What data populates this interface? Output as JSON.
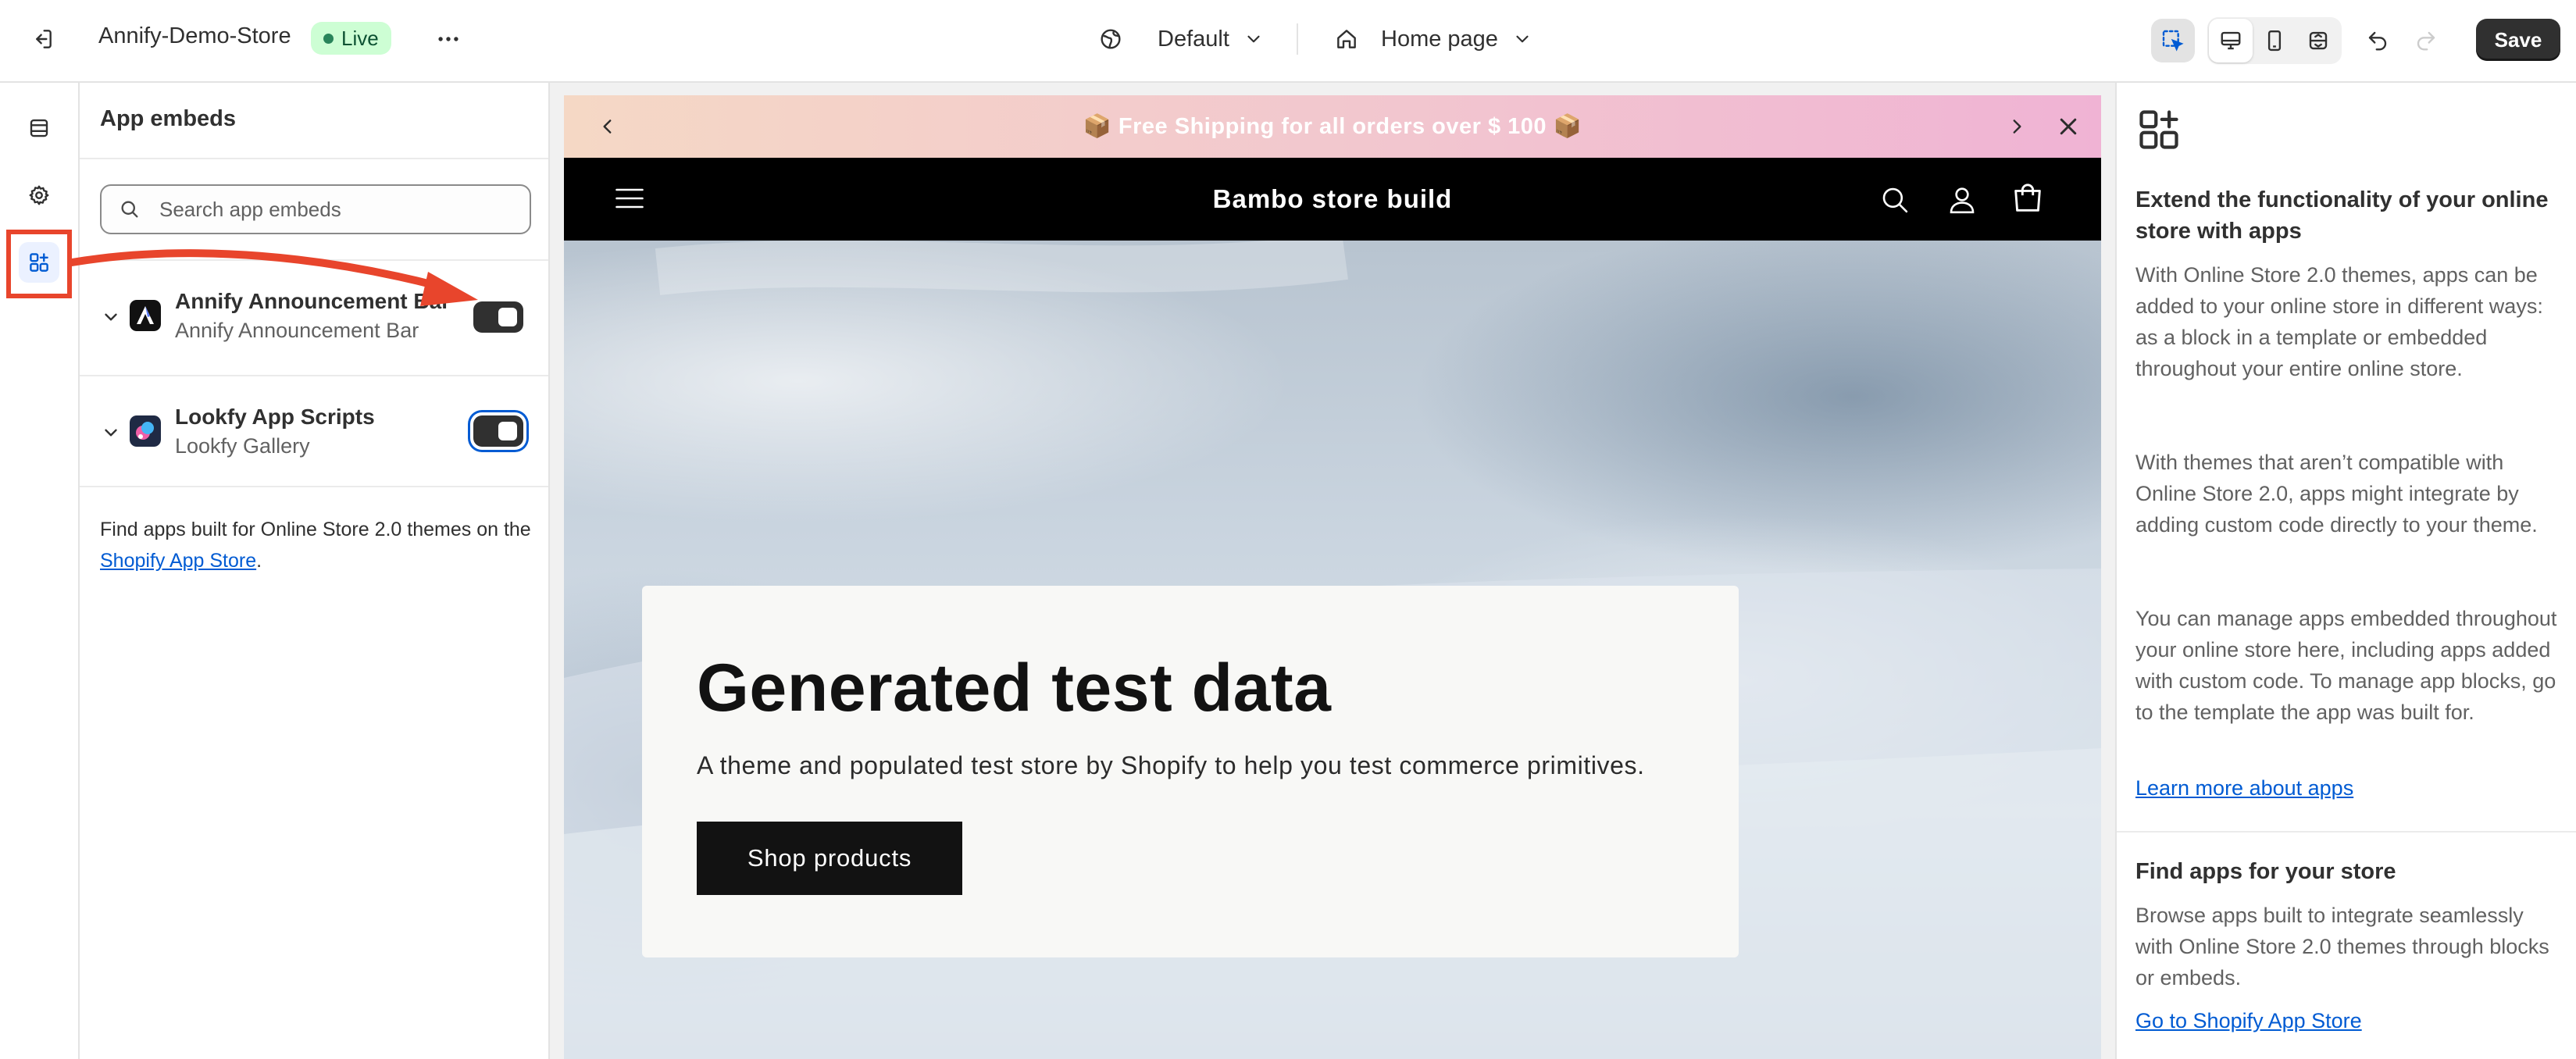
{
  "topbar": {
    "store_name": "Annify-Demo-Store",
    "status_badge": "Live",
    "theme_label": "Default",
    "page_label": "Home page",
    "save_label": "Save"
  },
  "sidebar": {
    "items": [
      {
        "icon": "sections-icon"
      },
      {
        "icon": "gear-icon"
      },
      {
        "icon": "app-embeds-icon",
        "active": true
      }
    ]
  },
  "panel": {
    "title": "App embeds",
    "search_placeholder": "Search app embeds",
    "embeds": [
      {
        "name": "Annify Announcement Bar",
        "subtitle": "Annify Announcement Bar",
        "enabled": true
      },
      {
        "name": "Lookfy App Scripts",
        "subtitle": "Lookfy Gallery",
        "enabled": true
      }
    ],
    "footer_text": "Find apps built for Online Store 2.0 themes on the ",
    "footer_link": "Shopify App Store",
    "footer_end": "."
  },
  "preview": {
    "announcement": "📦 Free Shipping for all orders over $ 100 📦",
    "store_title": "Bambo store build",
    "hero_heading": "Generated test data",
    "hero_text": "A theme and populated test store by Shopify to help you test commerce primitives.",
    "hero_button": "Shop products"
  },
  "info": {
    "title": "Extend the functionality of your online store with apps",
    "p1": "With Online Store 2.0 themes, apps can be added to your online store in different ways: as a block in a template or embedded throughout your entire online store.",
    "p2": "With themes that aren’t compatible with Online Store 2.0, apps might integrate by adding custom code directly to your theme.",
    "p3": "You can manage apps embedded throughout your online store here, including apps added with custom code. To manage app blocks, go to the template the app was built for.",
    "learn_link": "Learn more about apps",
    "find_title": "Find apps for your store",
    "find_text": "Browse apps built to integrate seamlessly with Online Store 2.0 themes through blocks or embeds.",
    "store_link": "Go to Shopify App Store"
  },
  "colors": {
    "annotation": "#e8452c",
    "focus": "#005bd3",
    "live_badge_bg": "#cdfed4",
    "announcement_gradient": [
      "#f5d8c5",
      "#f0b3d4"
    ]
  }
}
